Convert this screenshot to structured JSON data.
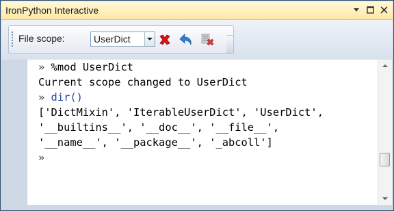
{
  "window": {
    "title": "IronPython Interactive",
    "controls": [
      "dropdown-icon",
      "maximize-icon",
      "close-icon"
    ]
  },
  "toolbar": {
    "file_scope_label": "File scope:",
    "scope_selected": "UserDict",
    "buttons": [
      {
        "name": "reset-scope-button",
        "icon": "red-x-icon"
      },
      {
        "name": "undo-button",
        "icon": "undo-arrow-icon"
      },
      {
        "name": "clear-button",
        "icon": "clear-icon"
      }
    ]
  },
  "repl": {
    "lines": [
      {
        "prompt": "» ",
        "text": "%mod UserDict"
      },
      {
        "prompt": "",
        "text": "Current scope changed to UserDict"
      },
      {
        "prompt": "» ",
        "text": "dir()"
      },
      {
        "prompt": "",
        "text": "['DictMixin', 'IterableUserDict', 'UserDict',"
      },
      {
        "prompt": "",
        "text": "'__builtins__', '__doc__', '__file__',"
      },
      {
        "prompt": "",
        "text": "'__name__', '__package__', '_abcoll']"
      },
      {
        "prompt": "»",
        "text": ""
      }
    ]
  },
  "colors": {
    "title_bg": "#ffe8a6",
    "frame": "#cfd9e6",
    "call_text": "#1a4aa8"
  }
}
